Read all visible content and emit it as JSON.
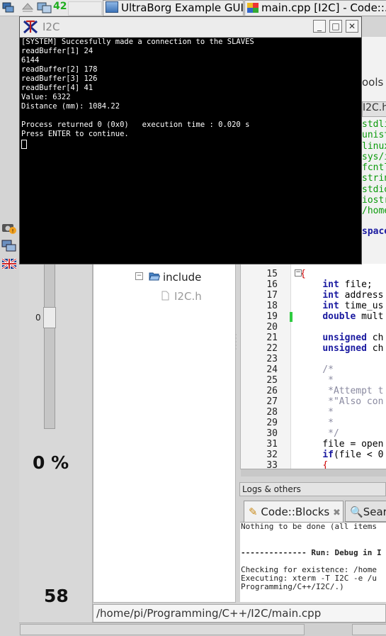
{
  "taskbar": {
    "workspace_count": "42",
    "tasks": [
      {
        "label": "UltraBorg Example GUI"
      },
      {
        "label": "main.cpp [I2C] - Code::..."
      }
    ]
  },
  "terminal": {
    "title": "I2C",
    "lines": [
      "[SYSTEM] Succesfully made a connection to the SLAVES",
      "readBuffer[1] 24",
      "6144",
      "readBuffer[2] 178",
      "readBuffer[3] 126",
      "readBuffer[4] 41",
      "Value: 6322",
      "Distance (mm): 1084.22",
      "",
      "Process returned 0 (0x0)   execution time : 0.020 s",
      "Press ENTER to continue."
    ]
  },
  "ultraborg": {
    "slider_value": "0",
    "slider_level": 0,
    "percent": "0 %",
    "count": "58"
  },
  "codeblocks": {
    "menu_tools": "ools",
    "editor_tab": "I2C.h",
    "header_list": [
      "stdli",
      "unist",
      "linux",
      "sys/i",
      "fcntl",
      "strin",
      "stdio",
      "iostr",
      "/home"
    ],
    "namespace_frag": "space",
    "tree": {
      "folder": "include",
      "file": "I2C.h"
    },
    "code": [
      {
        "n": "15",
        "t": "{"
      },
      {
        "n": "16",
        "t": "    int file;"
      },
      {
        "n": "17",
        "t": "    int address"
      },
      {
        "n": "18",
        "t": "    int time_us"
      },
      {
        "n": "19",
        "t": "    double mult"
      },
      {
        "n": "20",
        "t": ""
      },
      {
        "n": "21",
        "t": "    unsigned ch"
      },
      {
        "n": "22",
        "t": "    unsigned ch"
      },
      {
        "n": "23",
        "t": ""
      },
      {
        "n": "24",
        "t": "    /*"
      },
      {
        "n": "25",
        "t": "     *"
      },
      {
        "n": "26",
        "t": "     *Attempt t"
      },
      {
        "n": "27",
        "t": "     *\"Also con"
      },
      {
        "n": "28",
        "t": "     *"
      },
      {
        "n": "29",
        "t": "     *"
      },
      {
        "n": "30",
        "t": "     */"
      },
      {
        "n": "31",
        "t": "    file = open"
      },
      {
        "n": "32",
        "t": "    if(file < 0"
      },
      {
        "n": "33",
        "t": "    {"
      }
    ],
    "logs_title": "Logs & others",
    "logs_tabs": [
      "Code::Blocks",
      "Search"
    ],
    "logs_lines": [
      "Nothing to be done (all items",
      "",
      "",
      "-------------- Run: Debug in I",
      "",
      "Checking for existence: /home",
      "Executing: xterm -T I2C -e /u",
      "Programming/C++/I2C/.)"
    ],
    "status_path": "/home/pi/Programming/C++/I2C/main.cpp"
  }
}
